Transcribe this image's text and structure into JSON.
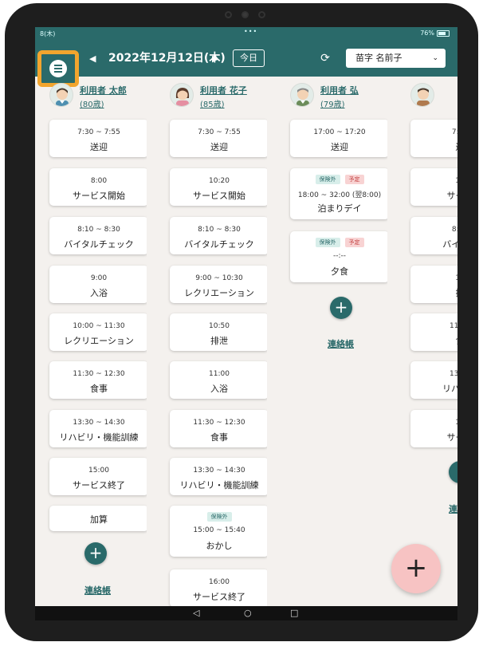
{
  "status": {
    "time": "8(木)",
    "dots": "•••",
    "battery": "76%"
  },
  "header": {
    "date": "2022年12月12日(木)",
    "today_label": "今日",
    "staff_select": "苗字 名前子",
    "prev_icon": "◀",
    "next_icon": "▶",
    "refresh_icon": "⟳",
    "chevron": "⌄"
  },
  "nav": {
    "back": "◁",
    "home": "○",
    "recent": "□"
  },
  "fab_label": "+",
  "columns": [
    {
      "name": "利用者 太郎",
      "age": "(80歳)",
      "add": "+",
      "contact": "連絡帳",
      "cards": [
        {
          "time": "7:30 ~ 7:55",
          "label": "送迎"
        },
        {
          "time": "8:00",
          "label": "サービス開始"
        },
        {
          "time": "8:10 ~ 8:30",
          "label": "バイタルチェック"
        },
        {
          "time": "9:00",
          "label": "入浴"
        },
        {
          "time": "10:00 ~ 11:30",
          "label": "レクリエーション"
        },
        {
          "time": "11:30 ~ 12:30",
          "label": "食事"
        },
        {
          "time": "13:30 ~ 14:30",
          "label": "リハビリ・機能訓練"
        },
        {
          "time": "15:00",
          "label": "サービス終了"
        },
        {
          "time": "",
          "label": "加算"
        }
      ]
    },
    {
      "name": "利用者 花子",
      "age": "(85歳)",
      "cards": [
        {
          "time": "7:30 ~ 7:55",
          "label": "送迎"
        },
        {
          "time": "10:20",
          "label": "サービス開始"
        },
        {
          "time": "8:10 ~ 8:30",
          "label": "バイタルチェック"
        },
        {
          "time": "9:00 ~ 10:30",
          "label": "レクリエーション"
        },
        {
          "time": "10:50",
          "label": "排泄"
        },
        {
          "time": "11:00",
          "label": "入浴"
        },
        {
          "time": "11:30 ~ 12:30",
          "label": "食事"
        },
        {
          "time": "13:30 ~ 14:30",
          "label": "リハビリ・機能訓練"
        },
        {
          "badge": "保険外",
          "time": "15:00 ~ 15:40",
          "label": "おかし"
        },
        {
          "time": "16:00",
          "label": "サービス終了"
        }
      ]
    },
    {
      "name": "利用者 弘",
      "age": "(79歳)",
      "add": "+",
      "contact": "連絡帳",
      "cards": [
        {
          "time": "17:00 ~ 17:20",
          "label": "送迎"
        },
        {
          "badge": "保険外",
          "badge2": "予定",
          "time": "18:00 ~ 32:00 (翌8:00)",
          "label": "泊まりデイ"
        },
        {
          "badge": "保険外",
          "badge2": "予定",
          "time": "--:--",
          "label": "夕食"
        }
      ]
    },
    {
      "contact": "連",
      "cards": [
        {
          "time": "7:30",
          "label": "送"
        },
        {
          "time": "10",
          "label": "サービ"
        },
        {
          "time": "8:10",
          "label": "バイタル"
        },
        {
          "time": "10",
          "label": "排"
        },
        {
          "time": "11:30",
          "label": "食"
        },
        {
          "time": "13:30",
          "label": "リハビリ"
        },
        {
          "time": "10",
          "label": "サービ"
        }
      ]
    }
  ]
}
